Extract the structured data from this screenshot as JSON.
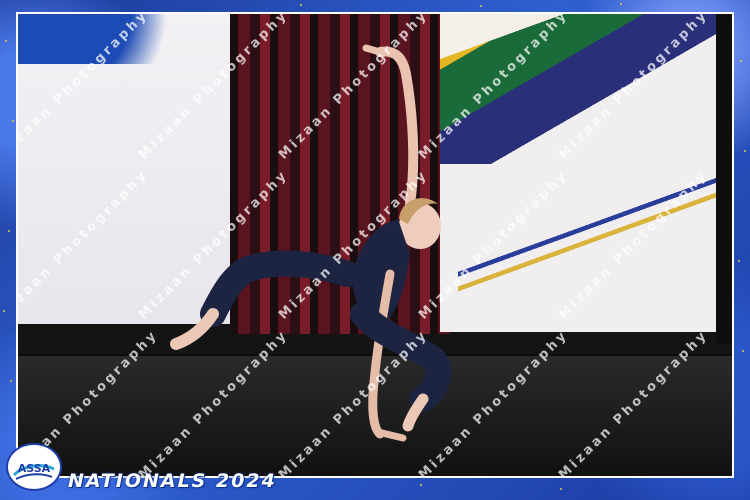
{
  "photo": {
    "subject": "dancer",
    "watermark_text": "Mizaan Photography"
  },
  "footer": {
    "event_title": "NATIONALS 2024",
    "logo_text": "ASSA"
  },
  "colors": {
    "frame_blue": "#1f3e9e",
    "frame_gold": "#e9c44a",
    "costume_navy": "#1c2442"
  }
}
